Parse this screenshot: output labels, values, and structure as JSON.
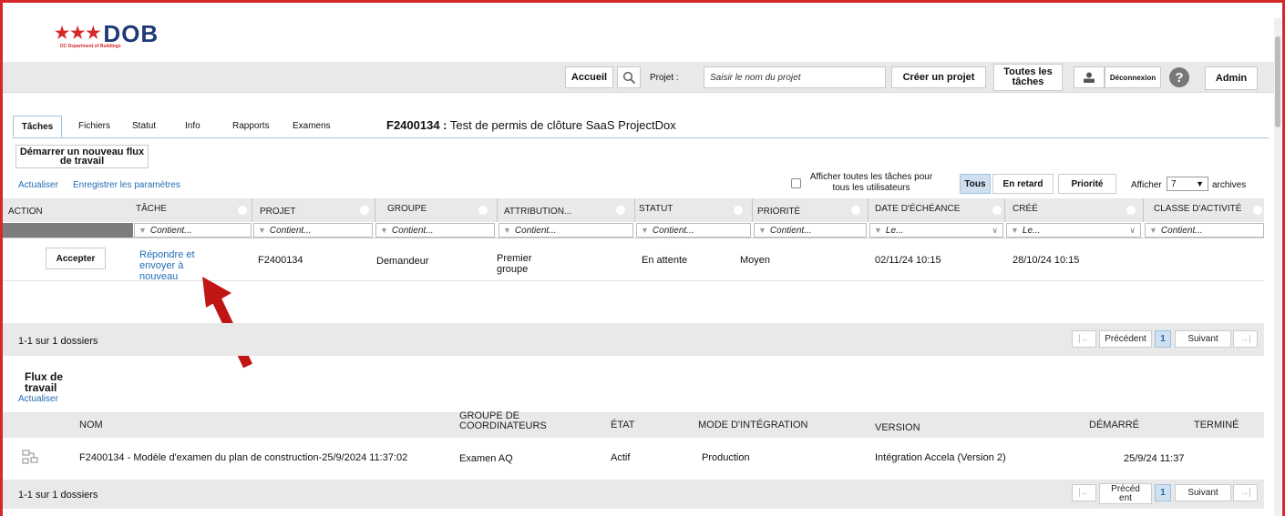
{
  "brand": {
    "logo_text": "DOB",
    "logo_stars": "★★★",
    "logo_sub": "DC Department of Buildings"
  },
  "topbar": {
    "home": "Accueil",
    "search_icon": "search-icon",
    "project_label": "Projet :",
    "project_placeholder": "Saisir le nom du projet",
    "create_project": "Créer un projet",
    "all_tasks": "Toutes les tâches",
    "user_icon": "user-icon",
    "logout": "Déconnexion",
    "help": "?",
    "admin": "Admin"
  },
  "tabs": [
    "Tâches",
    "Fichiers",
    "Statut",
    "Info",
    "Rapports",
    "Examens"
  ],
  "project_title": {
    "id": "F2400134 :",
    "name": "Test de permis de clôture SaaS ProjectDox"
  },
  "tasks": {
    "start_workflow": "Démarrer un nouveau flux de travail",
    "refresh": "Actualiser",
    "save_settings": "Enregistrer les paramètres",
    "show_all_label": "Afficher toutes les tâches pour tous les utilisateurs",
    "filters": {
      "all": "Tous",
      "late": "En retard",
      "priority": "Priorité"
    },
    "show_label": "Afficher",
    "show_count": "7",
    "archives_label": "archives",
    "columns": [
      "ACTION",
      "TÂCHE",
      "PROJET",
      "GROUPE",
      "ATTRIBUTION...",
      "STATUT",
      "PRIORITÉ",
      "DATE D'ÉCHÉANCE",
      "CRÉÉ",
      "CLASSE D'ACTIVITÉ"
    ],
    "filter_contains": "Contient...",
    "filter_le": "Le...",
    "rows": [
      {
        "action": "Accepter",
        "task_line1": "Répondre et",
        "task_line2": "envoyer à",
        "task_line3": "nouveau",
        "project": "F2400134",
        "group": "Demandeur",
        "assign_line1": "Premier",
        "assign_line2": "groupe",
        "status": "En attente",
        "priority": "Moyen",
        "due": "02/11/24 10:15",
        "created": "28/10/24 10:15",
        "activity": ""
      }
    ],
    "footer": "1-1 sur 1 dossiers",
    "pager": {
      "first": "|←",
      "prev": "Précédent",
      "page": "1",
      "next": "Suivant",
      "last": "→|"
    }
  },
  "workflow": {
    "title_line1": "Flux de",
    "title_line2": "travail",
    "refresh": "Actualiser",
    "columns": {
      "name": "NOM",
      "group_line1": "GROUPE DE",
      "group_line2": "COORDINATEURS",
      "state": "ÉTAT",
      "mode": "MODE D'INTÉGRATION",
      "version": "VERSION",
      "started": "DÉMARRÉ",
      "finished": "TERMINÉ"
    },
    "rows": [
      {
        "icon": "workflow-icon",
        "name": "F2400134 - Modèle d'examen du plan de construction-25/9/2024 11:37:02",
        "group": "Examen AQ",
        "state": "Actif",
        "mode": "Production",
        "version": "Intégration Accela (Version 2)",
        "started": "25/9/24 11:37",
        "finished": ""
      }
    ],
    "footer": "1-1 sur 1 dossiers",
    "pager": {
      "first": "|←",
      "prev_line1": "Précéd",
      "prev_line2": "ent",
      "page": "1",
      "next": "Suivant",
      "last": "→|"
    }
  },
  "colors": {
    "accent": "#1f6db5",
    "brand": "#1f3a78",
    "frame": "#d62828",
    "arrow": "#c01515"
  }
}
